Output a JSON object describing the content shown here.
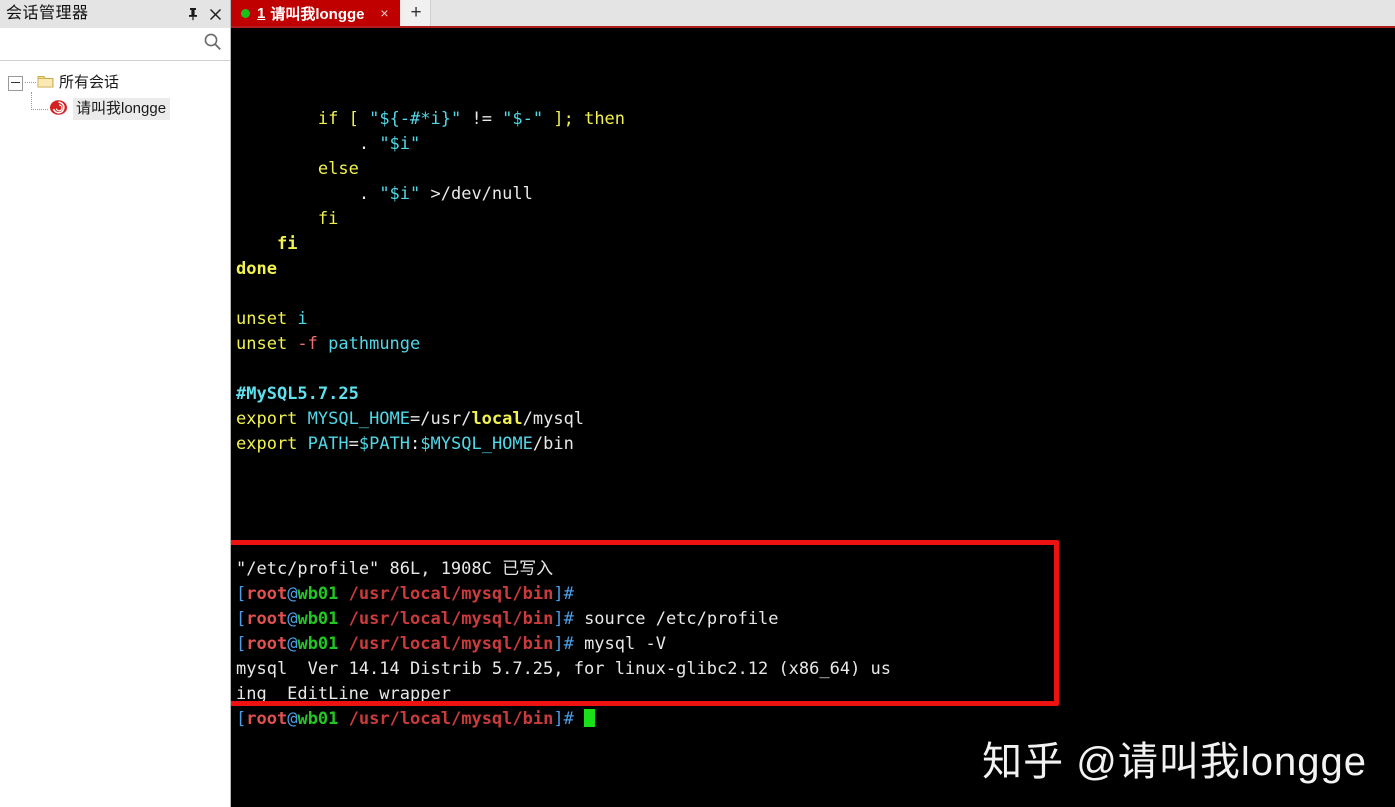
{
  "sidebar": {
    "title": "会话管理器",
    "pin_icon": "pin-icon",
    "close_icon": "close-icon",
    "search_icon": "search-icon",
    "tree": {
      "root": {
        "label": "所有会话",
        "icon": "folder-icon"
      },
      "child": {
        "label": "请叫我longge",
        "icon": "session-spiral-icon",
        "selected": true
      }
    }
  },
  "tabbar": {
    "tab": {
      "status_dot": "green-status-dot",
      "number": "1",
      "title": "请叫我longge",
      "close_label": "×"
    },
    "new_tab_label": "+"
  },
  "terminal": {
    "lines": [
      {
        "id": "l1",
        "indent": "        ",
        "tokens": [
          {
            "t": "if",
            "c": "yellow"
          },
          {
            "t": " [ ",
            "c": "yellow"
          },
          {
            "t": "\"${-#*i}\"",
            "c": "cyan"
          },
          {
            "t": " != ",
            "c": "white"
          },
          {
            "t": "\"$-\"",
            "c": "cyan"
          },
          {
            "t": " ]; ",
            "c": "yellow"
          },
          {
            "t": "then",
            "c": "yellow"
          }
        ]
      },
      {
        "id": "l2",
        "indent": "            ",
        "tokens": [
          {
            "t": ". ",
            "c": "white"
          },
          {
            "t": "\"$i\"",
            "c": "cyan"
          }
        ]
      },
      {
        "id": "l3",
        "indent": "        ",
        "tokens": [
          {
            "t": "else",
            "c": "yellow"
          }
        ]
      },
      {
        "id": "l4",
        "indent": "            ",
        "tokens": [
          {
            "t": ". ",
            "c": "white"
          },
          {
            "t": "\"$i\"",
            "c": "cyan"
          },
          {
            "t": " >/dev/null",
            "c": "white"
          }
        ]
      },
      {
        "id": "l5",
        "indent": "        ",
        "tokens": [
          {
            "t": "fi",
            "c": "yellow"
          }
        ]
      },
      {
        "id": "l6",
        "indent": "    ",
        "tokens": [
          {
            "t": "fi",
            "c": "yellow-b"
          }
        ]
      },
      {
        "id": "l7",
        "indent": "",
        "tokens": [
          {
            "t": "done",
            "c": "yellow-b"
          }
        ]
      },
      {
        "id": "l8",
        "indent": "",
        "tokens": []
      },
      {
        "id": "l9",
        "indent": "",
        "tokens": [
          {
            "t": "unset",
            "c": "yellow"
          },
          {
            "t": " i",
            "c": "cyan"
          }
        ]
      },
      {
        "id": "l10",
        "indent": "",
        "tokens": [
          {
            "t": "unset",
            "c": "yellow"
          },
          {
            "t": " -f",
            "c": "pink"
          },
          {
            "t": " pathmunge",
            "c": "cyan"
          }
        ]
      },
      {
        "id": "l11",
        "indent": "",
        "tokens": []
      },
      {
        "id": "l12",
        "indent": "",
        "tokens": [
          {
            "t": "#MySQL5.7.25",
            "c": "cyan-b"
          }
        ]
      },
      {
        "id": "l13",
        "indent": "",
        "tokens": [
          {
            "t": "export",
            "c": "yellow"
          },
          {
            "t": " MYSQL_HOME",
            "c": "cyan"
          },
          {
            "t": "=/usr/",
            "c": "white"
          },
          {
            "t": "local",
            "c": "yellow-b"
          },
          {
            "t": "/mysql",
            "c": "white"
          }
        ]
      },
      {
        "id": "l14",
        "indent": "",
        "tokens": [
          {
            "t": "export",
            "c": "yellow"
          },
          {
            "t": " PATH",
            "c": "cyan"
          },
          {
            "t": "=",
            "c": "white"
          },
          {
            "t": "$PATH",
            "c": "cyan"
          },
          {
            "t": ":",
            "c": "white"
          },
          {
            "t": "$MYSQL_HOME",
            "c": "cyan"
          },
          {
            "t": "/bin",
            "c": "white"
          }
        ]
      },
      {
        "id": "l15",
        "indent": "",
        "tokens": []
      },
      {
        "id": "l16",
        "indent": "",
        "tokens": []
      },
      {
        "id": "l17",
        "indent": "",
        "tokens": []
      },
      {
        "id": "l18",
        "indent": "",
        "tokens": []
      },
      {
        "id": "l19",
        "indent": "",
        "tokens": [
          {
            "t": "\"/etc/profile\" 86L, 1908C 已写入",
            "c": "white"
          }
        ]
      },
      {
        "id": "l20",
        "indent": "",
        "tokens": [
          {
            "t": "[",
            "c": "blue"
          },
          {
            "t": "root",
            "c": "root"
          },
          {
            "t": "@",
            "c": "blue"
          },
          {
            "t": "wb01",
            "c": "green"
          },
          {
            "t": " /usr/local/mysql/bin",
            "c": "prompt-red"
          },
          {
            "t": "]# ",
            "c": "blue"
          }
        ]
      },
      {
        "id": "l21",
        "indent": "",
        "tokens": [
          {
            "t": "[",
            "c": "blue"
          },
          {
            "t": "root",
            "c": "root"
          },
          {
            "t": "@",
            "c": "blue"
          },
          {
            "t": "wb01",
            "c": "green"
          },
          {
            "t": " /usr/local/mysql/bin",
            "c": "prompt-red"
          },
          {
            "t": "]# ",
            "c": "blue"
          },
          {
            "t": "source /etc/profile",
            "c": "white"
          }
        ]
      },
      {
        "id": "l22",
        "indent": "",
        "tokens": [
          {
            "t": "[",
            "c": "blue"
          },
          {
            "t": "root",
            "c": "root"
          },
          {
            "t": "@",
            "c": "blue"
          },
          {
            "t": "wb01",
            "c": "green"
          },
          {
            "t": " /usr/local/mysql/bin",
            "c": "prompt-red"
          },
          {
            "t": "]# ",
            "c": "blue"
          },
          {
            "t": "mysql -V",
            "c": "white"
          }
        ]
      },
      {
        "id": "l23",
        "indent": "",
        "tokens": [
          {
            "t": "mysql  Ver 14.14 Distrib 5.7.25, for linux-glibc2.12 (x86_64) us",
            "c": "white"
          }
        ]
      },
      {
        "id": "l24",
        "indent": "",
        "tokens": [
          {
            "t": "ing  EditLine wrapper",
            "c": "white"
          }
        ]
      },
      {
        "id": "l25",
        "indent": "",
        "tokens": [
          {
            "t": "[",
            "c": "blue"
          },
          {
            "t": "root",
            "c": "root"
          },
          {
            "t": "@",
            "c": "blue"
          },
          {
            "t": "wb01",
            "c": "green"
          },
          {
            "t": " /usr/local/mysql/bin",
            "c": "prompt-red"
          },
          {
            "t": "]# ",
            "c": "blue"
          },
          {
            "t": "",
            "c": "cursor"
          }
        ]
      }
    ],
    "annotation_box_color": "#ee1111"
  },
  "watermark": {
    "text": "知乎 @请叫我longge"
  }
}
